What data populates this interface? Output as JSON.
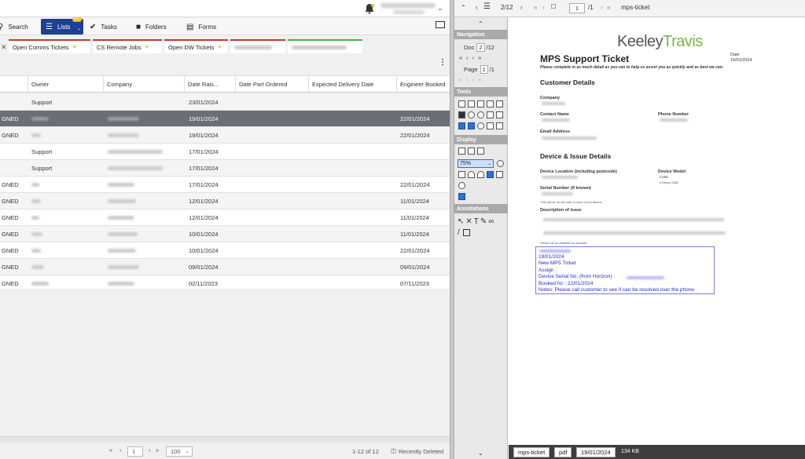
{
  "nav": {
    "search_label": "Search",
    "lists_label": "Lists",
    "lists_badge": "99+",
    "tasks_label": "Tasks",
    "folders_label": "Folders",
    "forms_label": "Forms"
  },
  "chips": [
    {
      "label": "Open Comms Tickets"
    },
    {
      "label": "CS Remote Jobs"
    },
    {
      "label": "Open DW Tickets"
    }
  ],
  "table": {
    "headers": [
      "Owner",
      "Company",
      "Date Rais...",
      "Date Part Ordered",
      "Expected Delivery Date",
      "Engineer Booked"
    ],
    "rows": [
      {
        "status": "",
        "owner": "Support",
        "date": "23/01/2024",
        "engineer": ""
      },
      {
        "status": "GNED",
        "owner": "",
        "date": "19/01/2024",
        "engineer": "22/01/2024"
      },
      {
        "status": "GNED",
        "owner": "",
        "date": "19/01/2024",
        "engineer": "22/01/2024"
      },
      {
        "status": "",
        "owner": "Support",
        "date": "17/01/2024",
        "engineer": ""
      },
      {
        "status": "",
        "owner": "Support",
        "date": "17/01/2024",
        "engineer": ""
      },
      {
        "status": "GNED",
        "owner": "",
        "date": "17/01/2024",
        "engineer": "22/01/2024"
      },
      {
        "status": "GNED",
        "owner": "",
        "date": "12/01/2024",
        "engineer": "11/01/2024"
      },
      {
        "status": "GNED",
        "owner": "",
        "date": "12/01/2024",
        "engineer": "11/01/2024"
      },
      {
        "status": "GNED",
        "owner": "",
        "date": "10/01/2024",
        "engineer": "11/01/2024"
      },
      {
        "status": "GNED",
        "owner": "",
        "date": "10/01/2024",
        "engineer": "22/01/2024"
      },
      {
        "status": "GNED",
        "owner": "",
        "date": "09/01/2024",
        "engineer": "09/01/2024"
      },
      {
        "status": "GNED",
        "owner": "",
        "date": "02/11/2023",
        "engineer": "07/11/2023"
      }
    ]
  },
  "pager": {
    "page": "1",
    "page_size": "100",
    "range": "1-12 of 12",
    "recently_deleted": "Recently Deleted"
  },
  "viewer": {
    "doc_count": "2/12",
    "page_input": "1",
    "page_total": "/1",
    "doc_name": "mps-ticket",
    "nav_heading": "Navigation",
    "doc_label": "Doc",
    "doc_value": "2",
    "doc_total": "/12",
    "page_label": "Page",
    "page_value": "1",
    "page_value_total": "/1",
    "tools_heading": "Tools",
    "display_heading": "Display",
    "zoom": "75%",
    "annotations_heading": "Annotations",
    "footer_tags": [
      "mps-ticket",
      "pdf",
      "19/01/2024"
    ],
    "file_size": "134 KB"
  },
  "document": {
    "logo_a": "Keeley",
    "logo_b": "Travis",
    "title": "MPS Support Ticket",
    "date_label": "Date",
    "date_value": "19/01/2024",
    "instructions": "Please complete in as much detail as you can to help us assist you as quickly and as best we can.",
    "sec_customer": "Customer Details",
    "company_label": "Company",
    "contact_label": "Contact Name",
    "phone_label": "Phone Number",
    "email_label": "Email Address",
    "sec_device": "Device & Issue Details",
    "location_label": "Device Location (including postcode)",
    "model_label": "Device Model",
    "model_value": "C258",
    "model_value2": "& Kinsey C308",
    "serial_label": "Serial Number (if known)",
    "serial_note": "This will be on the side or back of the device.",
    "description_label": "Description of issue",
    "detail_note": "Please be as detailed as possible.",
    "notes": [
      "19/01/2024",
      "New MPS Ticket",
      "Assign :",
      "Device Serial No. (from Horizon) :",
      "Booked for :  22/01/2024",
      "Notes: Please call customer to see if can be resolved over the phone"
    ]
  }
}
